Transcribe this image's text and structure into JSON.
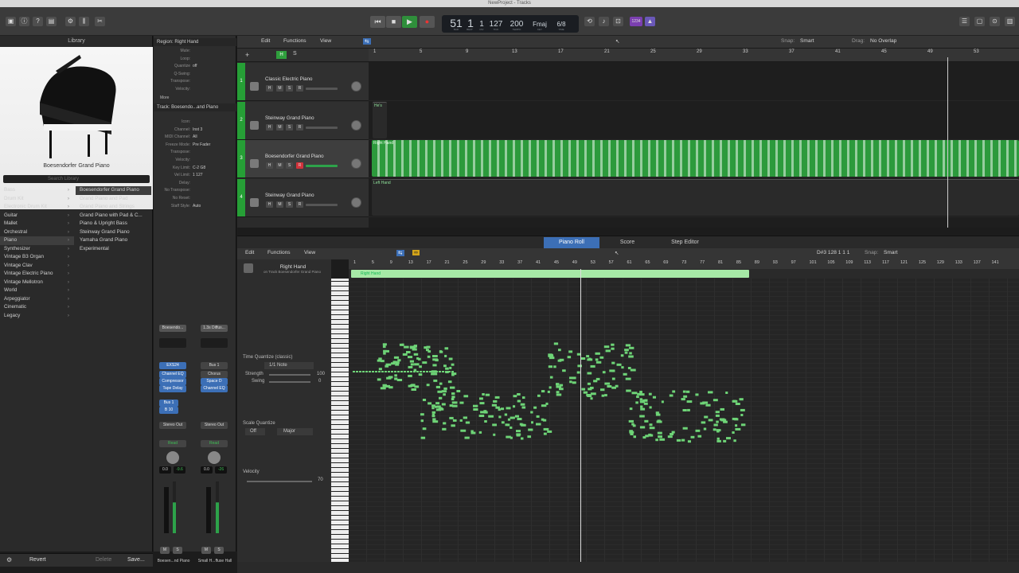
{
  "window": {
    "title": "NewProject - Tracks"
  },
  "transport": {
    "bar": "51",
    "beat": "1",
    "div": "1",
    "tick": "127",
    "tempo": "200",
    "key": "Fmaj",
    "signature": "6/8",
    "labels": {
      "bar": "BAR",
      "beat": "BEAT",
      "div": "DIV",
      "tick": "TICK",
      "tempo": "TEMPO",
      "key": "KEY",
      "sig": "TIME"
    },
    "count_in": "1234"
  },
  "library": {
    "title": "Library",
    "patch_name": "Boesendorfer Grand Piano",
    "search_placeholder": "Search Library",
    "categories": [
      "Bass",
      "Drum Kit",
      "Electronic Drum Kit",
      "Guitar",
      "Mallet",
      "Orchestral",
      "Piano",
      "Synthesizer",
      "Vintage B3 Organ",
      "Vintage Clav",
      "Vintage Electric Piano",
      "Vintage Mellotron",
      "World",
      "Arpeggiator",
      "Cinematic",
      "Legacy"
    ],
    "selected_category": "Piano",
    "patches": [
      "Boesendorfer Grand Piano",
      "Grand Piano and Pad",
      "Grand Piano and Strings",
      "Grand Piano with Pad & C...",
      "Piano & Upright Bass",
      "Steinway Grand Piano",
      "Yamaha Grand Piano",
      "Experimental"
    ],
    "selected_patch": "Boesendorfer Grand Piano",
    "footer": {
      "revert": "Revert",
      "delete": "Delete",
      "save": "Save..."
    }
  },
  "inspector": {
    "region_header": "Region: Right Hand",
    "region_rows": [
      {
        "k": "Mute:",
        "v": ""
      },
      {
        "k": "Loop:",
        "v": ""
      },
      {
        "k": "Quantize",
        "v": "off"
      },
      {
        "k": "Q-Swing:",
        "v": ""
      },
      {
        "k": "Transpose:",
        "v": ""
      },
      {
        "k": "Velocity:",
        "v": ""
      }
    ],
    "more": "More",
    "track_header": "Track: Boesendo...and Piano",
    "track_rows": [
      {
        "k": "Icon:",
        "v": ""
      },
      {
        "k": "Channel:",
        "v": "Inst 3"
      },
      {
        "k": "MIDI Channel:",
        "v": "All"
      },
      {
        "k": "Freeze Mode:",
        "v": "Pre Fader"
      },
      {
        "k": "Transpose:",
        "v": ""
      },
      {
        "k": "Velocity:",
        "v": ""
      },
      {
        "k": "Key Limit:",
        "v": "C-2   G8"
      },
      {
        "k": "Vel Limit:",
        "v": "1   127"
      },
      {
        "k": "Delay:",
        "v": ""
      },
      {
        "k": "No Transpose:",
        "v": ""
      },
      {
        "k": "No Reset:",
        "v": ""
      },
      {
        "k": "Staff Style:",
        "v": "Auto"
      }
    ],
    "strip1": {
      "setting": "Boesendo...",
      "instrument": "EXS24",
      "fx": [
        "Channel EQ",
        "Compressor",
        "Tape Delay"
      ],
      "bus": "Bus 1",
      "bus2": "B 10",
      "output": "Stereo Out",
      "auto": "Read",
      "vol": "0.0",
      "peak": "-9.6",
      "name": "Boesen...nd Piano",
      "m": "M",
      "s": "S"
    },
    "strip2": {
      "setting": "1.3s Diffus...",
      "bus": "Bus 1",
      "fx": [
        "Chorus",
        "Space D",
        "Channel EQ"
      ],
      "output": "Stereo Out",
      "auto": "Read",
      "vol": "0.0",
      "peak": "-26",
      "name": "Small H...ffuse Hall",
      "m": "M",
      "s": "S"
    }
  },
  "tracks_toolbar": {
    "edit": "Edit",
    "functions": "Functions",
    "view": "View",
    "snap_label": "Snap:",
    "snap": "Smart",
    "drag_label": "Drag:",
    "drag": "No Overlap"
  },
  "ruler": [
    "1",
    "5",
    "9",
    "13",
    "17",
    "21",
    "25",
    "29",
    "33",
    "37",
    "41",
    "45",
    "49",
    "53"
  ],
  "tracks": [
    {
      "num": "1",
      "name": "Classic Electric Piano",
      "selected": false,
      "regions": []
    },
    {
      "num": "2",
      "name": "Steinway Grand Piano",
      "selected": false,
      "regions": [
        {
          "label": "He's"
        }
      ]
    },
    {
      "num": "3",
      "name": "Boesendorfer Grand Piano",
      "selected": true,
      "regions": [
        {
          "label": "Right Hand"
        }
      ]
    },
    {
      "num": "4",
      "name": "Steinway Grand Piano",
      "selected": false,
      "regions": [
        {
          "label": "Left Hand"
        }
      ]
    }
  ],
  "editor": {
    "tabs": [
      "Piano Roll",
      "Score",
      "Step Editor"
    ],
    "active_tab": "Piano Roll",
    "edit": "Edit",
    "functions": "Functions",
    "view": "View",
    "position": "D#3  128 1 1 1",
    "snap_label": "Snap:",
    "snap": "Smart",
    "region_name": "Right Hand",
    "region_track": "on Track Boesendorfer Grand Piano",
    "time_quantize_label": "Time Quantize (classic)",
    "time_quantize": "1/1 Note",
    "strength_label": "Strength",
    "strength": "100",
    "swing_label": "Swing",
    "swing": "0",
    "scale_quantize_label": "Scale Quantize",
    "scale_off": "Off",
    "scale_mode": "Major",
    "velocity_label": "Velocity",
    "velocity": "70",
    "ruler": [
      "1",
      "5",
      "9",
      "13",
      "17",
      "21",
      "25",
      "29",
      "33",
      "37",
      "41",
      "45",
      "49",
      "53",
      "57",
      "61",
      "65",
      "69",
      "73",
      "77",
      "81",
      "85",
      "89",
      "93",
      "97",
      "101",
      "105",
      "109",
      "113",
      "117",
      "121",
      "125",
      "129",
      "133",
      "137",
      "141"
    ],
    "region_bar_label": "Right Hand"
  },
  "colors": {
    "accent": "#2a9f3b",
    "region_green": "#2c9a3c",
    "note_green": "#6ed477",
    "selected_blue": "#3c6fb6"
  }
}
